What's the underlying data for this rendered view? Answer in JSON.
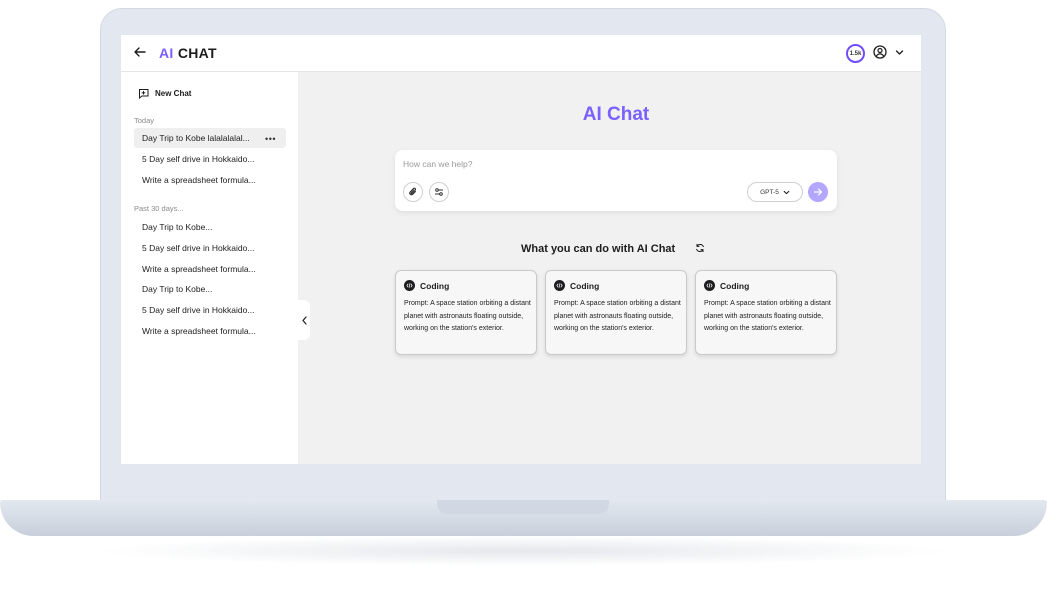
{
  "header": {
    "logo_ai": "AI",
    "logo_chat": "CHAT",
    "credits": "1.5k"
  },
  "sidebar": {
    "new_chat_label": "New Chat",
    "today_label": "Today",
    "today_items": [
      "Day Trip to Kobe lalalalalal...",
      "5 Day self drive in Hokkaido...",
      "Write a spreadsheet formula..."
    ],
    "past_label": "Past 30 days...",
    "past_items": [
      "Day Trip to Kobe...",
      "5 Day self drive in Hokkaido...",
      "Write a spreadsheet formula...",
      "Day Trip to Kobe...",
      "5 Day self drive in Hokkaido...",
      "Write a spreadsheet formula..."
    ]
  },
  "main": {
    "title": "AI Chat",
    "prompt_placeholder": "How can we help?",
    "model_label": "GPT-5",
    "suggest_title": "What you can do with AI Chat",
    "cards": [
      {
        "title": "Coding",
        "body": "Prompt: A space station orbiting a distant planet with astronauts floating outside, working on the station's exterior."
      },
      {
        "title": "Coding",
        "body": "Prompt: A space station orbiting a distant planet with astronauts floating outside, working on the station's exterior."
      },
      {
        "title": "Coding",
        "body": "Prompt: A space station orbiting a distant planet with astronauts floating outside, working on the station's exterior."
      }
    ]
  },
  "colors": {
    "accent": "#7b61ff",
    "send_button": "#b3a6ff"
  },
  "icons": [
    "back-arrow-icon",
    "user-icon",
    "chevron-down-icon",
    "new-chat-icon",
    "more-icon",
    "chevron-left-icon",
    "paperclip-icon",
    "settings-sliders-icon",
    "arrow-right-icon",
    "refresh-icon",
    "code-icon"
  ]
}
